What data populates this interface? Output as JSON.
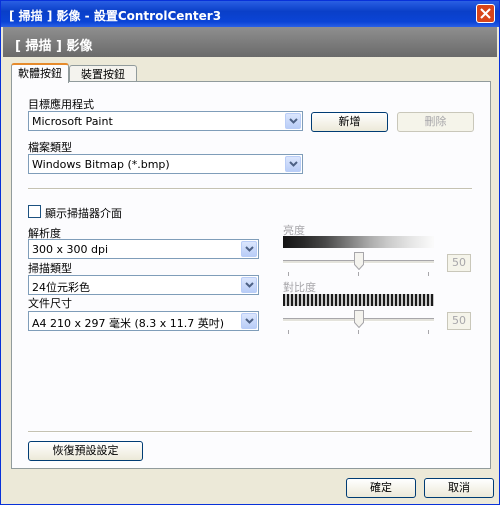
{
  "window": {
    "title": "[ 掃描 ] 影像 - 設置ControlCenter3"
  },
  "header": {
    "title": "[ 掃描 ] 影像"
  },
  "tabs": [
    {
      "label": "軟體按鈕"
    },
    {
      "label": "裝置按鈕"
    }
  ],
  "app": {
    "label": "目標應用程式",
    "selected": "Microsoft Paint",
    "add_label": "新增",
    "delete_label": "刪除"
  },
  "file_type": {
    "label": "檔案類型",
    "selected": "Windows Bitmap (*.bmp)"
  },
  "show_scanner_interface": {
    "label": "顯示掃描器介面",
    "checked": false
  },
  "resolution": {
    "label": "解析度",
    "selected": "300 x 300 dpi"
  },
  "scan_type": {
    "label": "掃描類型",
    "selected": "24位元彩色"
  },
  "doc_size": {
    "label": "文件尺寸",
    "selected": "A4 210 x 297 毫米 (8.3 x 11.7 英吋)"
  },
  "brightness": {
    "label": "亮度",
    "value": "50"
  },
  "contrast": {
    "label": "對比度",
    "value": "50"
  },
  "restore_defaults_label": "恢復預設設定",
  "ok_label": "確定",
  "cancel_label": "取消"
}
